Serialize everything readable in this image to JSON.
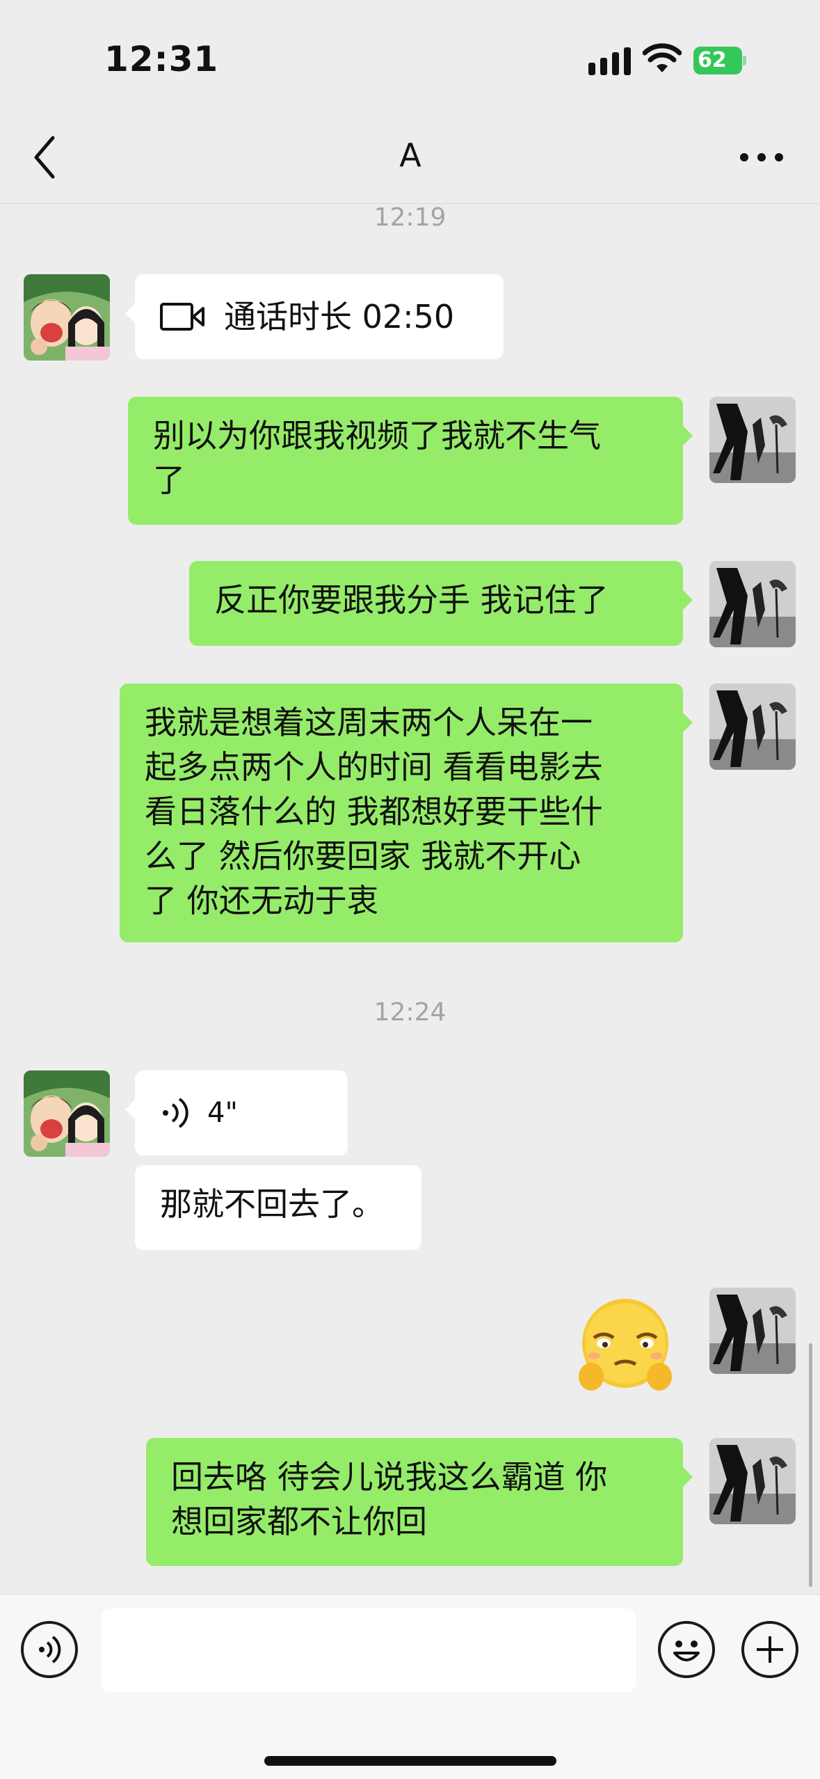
{
  "status_bar": {
    "time": "12:31",
    "battery": "62",
    "icons": [
      "signal-icon",
      "wifi-icon",
      "battery-charging-icon"
    ]
  },
  "nav": {
    "title": "A",
    "back_icon": "chevron-left-icon",
    "more_icon": "more-dots-icon"
  },
  "timestamps": {
    "first": "12:19",
    "second": "12:24"
  },
  "messages": {
    "call": {
      "icon": "video-camera-icon",
      "text": "通话时长 02:50"
    },
    "out1": {
      "line1": "别以为你跟我视频了我就不生气",
      "line2": "了"
    },
    "out2": {
      "text": "反正你要跟我分手 我记住了"
    },
    "out3": {
      "line1": "我就是想着这周末两个人呆在一",
      "line2": "起多点两个人的时间 看看电影去",
      "line3": "看日落什么的 我都想好要干些什",
      "line4": "么了 然后你要回家 我就不开心",
      "line5": "了 你还无动于衷"
    },
    "voice": {
      "icon": "voice-wave-icon",
      "duration": "4\""
    },
    "in2": {
      "text": "那就不回去了。"
    },
    "sticker": {
      "icon": "tired-face-emoji-icon"
    },
    "out4": {
      "line1": "回去咯 待会儿说我这么霸道 你",
      "line2": "想回家都不让你回"
    }
  },
  "input_bar": {
    "placeholder": "",
    "icons": [
      "voice-input-icon",
      "emoji-icon",
      "plus-icon"
    ]
  },
  "colors": {
    "background": "#ededed",
    "outgoing_bubble": "#95ec69",
    "incoming_bubble": "#ffffff",
    "battery": "#34c759"
  }
}
